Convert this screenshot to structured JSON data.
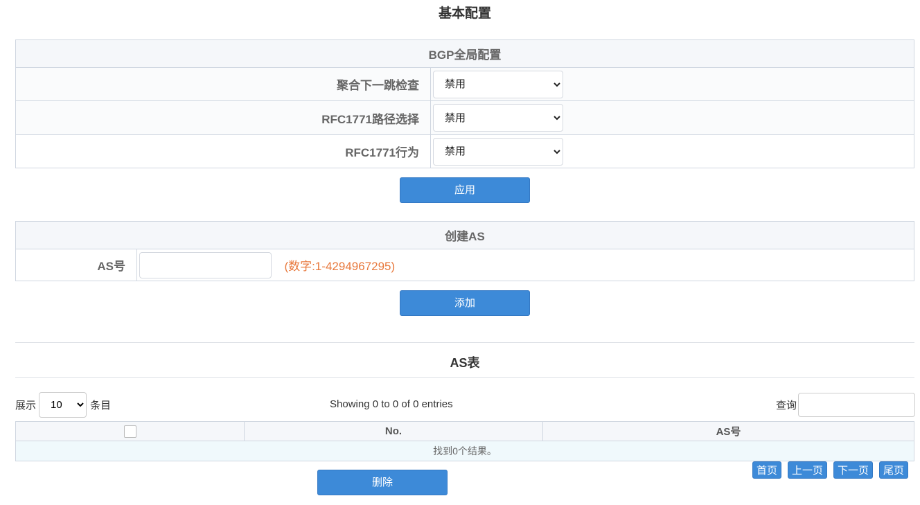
{
  "page": {
    "title": "基本配置"
  },
  "bgp_global": {
    "header": "BGP全局配置",
    "rows": [
      {
        "label": "聚合下一跳检查",
        "value": "禁用"
      },
      {
        "label": "RFC1771路径选择",
        "value": "禁用"
      },
      {
        "label": "RFC1771行为",
        "value": "禁用"
      }
    ],
    "apply_label": "应用"
  },
  "create_as": {
    "header": "创建AS",
    "label": "AS号",
    "value": "",
    "hint": "(数字:1-4294967295)",
    "add_label": "添加"
  },
  "as_table": {
    "title": "AS表",
    "length_prefix": "展示",
    "length_value": "10",
    "length_suffix": "条目",
    "info": "Showing 0 to 0 of 0 entries",
    "search_label": "查询",
    "columns": [
      "",
      "No.",
      "AS号"
    ],
    "empty_message": "找到0个结果。",
    "delete_label": "删除",
    "pager": [
      "首页",
      "上一页",
      "下一页",
      "尾页"
    ]
  },
  "colors": {
    "accent": "#3d8ad8",
    "hint": "#e8793d",
    "header_bg": "#f5f7fa",
    "empty_row_bg": "#f0f9fc"
  }
}
